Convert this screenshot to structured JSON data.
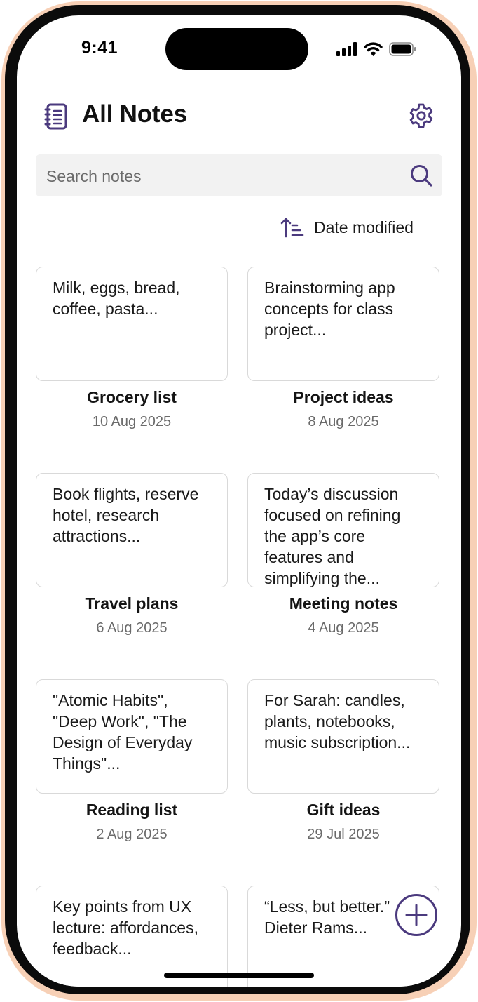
{
  "status_bar": {
    "time": "9:41"
  },
  "header": {
    "title": "All Notes"
  },
  "search": {
    "placeholder": "Search notes",
    "value": ""
  },
  "sort": {
    "label": "Date modified"
  },
  "notes": [
    {
      "preview": "Milk, eggs, bread, coffee, pasta...",
      "title": "Grocery list",
      "date": "10 Aug 2025"
    },
    {
      "preview": "Brainstorming app concepts for class project...",
      "title": "Project ideas",
      "date": "8 Aug 2025"
    },
    {
      "preview": "Book flights, reserve hotel, research attractions...",
      "title": "Travel plans",
      "date": "6 Aug 2025"
    },
    {
      "preview": "Today’s discussion focused on refining the app’s core features and simplifying the...",
      "title": "Meeting notes",
      "date": "4 Aug 2025"
    },
    {
      "preview": "\"Atomic Habits\", \"Deep Work\", \"The Design of Everyday Things\"...",
      "title": "Reading list",
      "date": "2 Aug 2025"
    },
    {
      "preview": "For Sarah: candles, plants, notebooks, music subscription...",
      "title": "Gift ideas",
      "date": "29 Jul 2025"
    },
    {
      "preview": "Key points from UX lecture: affordances, feedback...",
      "title": "",
      "date": ""
    },
    {
      "preview": "“Less, but better.” Dieter Rams...",
      "title": "",
      "date": ""
    }
  ],
  "colors": {
    "accent": "#4b3a7e",
    "search_bg": "#f2f2f2",
    "card_border": "#d9d9d9",
    "frame": "#f7d0b6"
  },
  "icons": {
    "header": "notebook-icon",
    "settings": "gear-icon",
    "search": "search-icon",
    "sort": "sort-ascending-icon",
    "fab": "plus-icon"
  }
}
